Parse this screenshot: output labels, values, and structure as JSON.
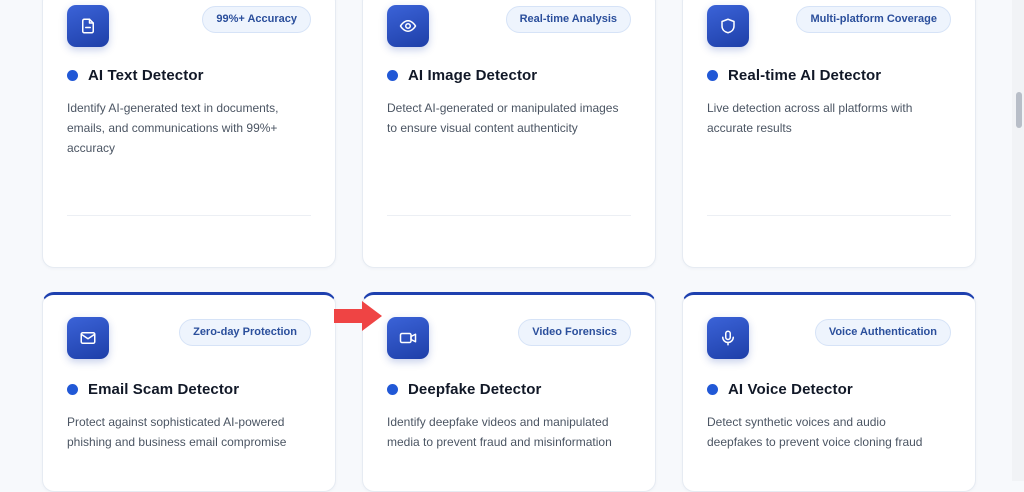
{
  "cards": [
    {
      "title": "AI Text Detector",
      "badge": "99%+ Accuracy",
      "icon": "document-icon",
      "desc": "Identify AI-generated text in documents, emails, and communications with 99%+ accuracy"
    },
    {
      "title": "AI Image Detector",
      "badge": "Real-time Analysis",
      "icon": "eye-icon",
      "desc": "Detect AI-generated or manipulated images to ensure visual content authenticity"
    },
    {
      "title": "Real-time AI Detector",
      "badge": "Multi-platform Coverage",
      "icon": "shield-icon",
      "desc": "Live detection across all platforms with accurate results"
    },
    {
      "title": "Email Scam Detector",
      "badge": "Zero-day Protection",
      "icon": "mail-icon",
      "desc": "Protect against sophisticated AI-powered phishing and business email compromise"
    },
    {
      "title": "Deepfake Detector",
      "badge": "Video Forensics",
      "icon": "video-camera-icon",
      "desc": "Identify deepfake videos and manipulated media to prevent fraud and misinformation"
    },
    {
      "title": "AI Voice Detector",
      "badge": "Voice Authentication",
      "icon": "microphone-icon",
      "desc": "Detect synthetic voices and audio deepfakes to prevent voice cloning fraud"
    }
  ],
  "colors": {
    "accent": "#1e40af",
    "dot": "#2158d6",
    "arrow": "#ef4444",
    "badge_text": "#2b4f9c"
  }
}
